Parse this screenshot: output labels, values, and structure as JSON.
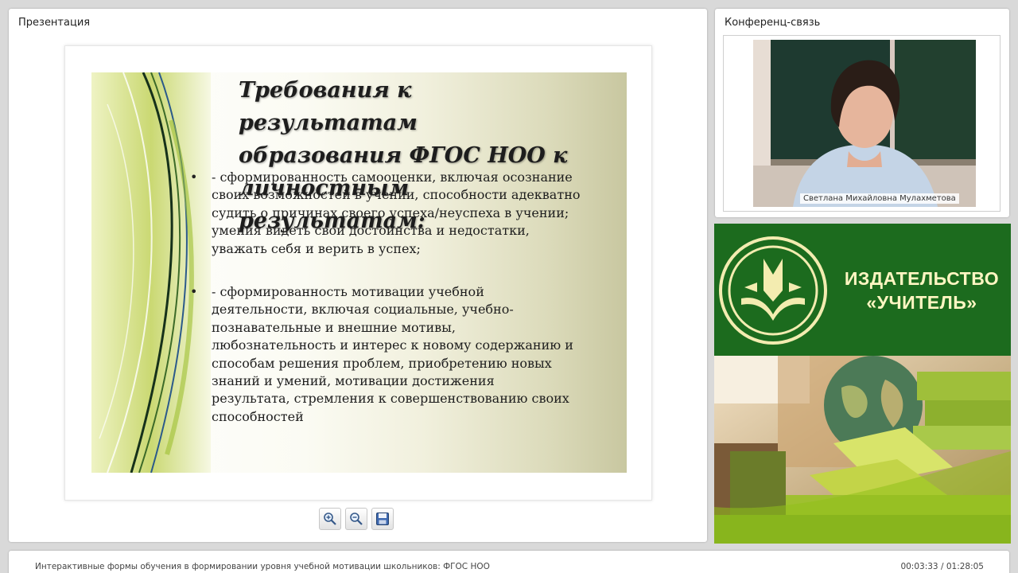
{
  "presentation": {
    "panel_title": "Презентация",
    "slide": {
      "title_lines": [
        "Требования к результатам",
        "образования ФГОС НОО к",
        "личностным результатам:"
      ],
      "bullet_symbol": "•",
      "bullets": [
        {
          "lines": [
            "- сформированность самооценки, включая осознание",
            "своих возможностей в учении, способности адекватно",
            "судить о причинах своего успеха/неуспеха в учении;",
            "умения видеть свои достоинства и недостатки,",
            "уважать себя и верить в успех;"
          ]
        },
        {
          "lines": [
            " - сформированность мотивации учебной",
            "деятельности, включая социальные, учебно-",
            "познавательные и внешние мотивы,",
            "любознательность и интерес к новому содержанию и",
            "способам решения проблем, приобретению новых",
            "знаний и умений, мотивации достижения",
            "результата, стремления к совершенствованию своих",
            "способностей"
          ]
        }
      ]
    },
    "controls": [
      {
        "name": "zoom-in",
        "icon": "zoom-in-icon"
      },
      {
        "name": "zoom-out",
        "icon": "zoom-out-icon"
      },
      {
        "name": "save",
        "icon": "floppy-disk-icon"
      }
    ]
  },
  "conference": {
    "panel_title": "Конференц-связь",
    "speaker_name": "Светлана Михайловна Мулахметова"
  },
  "promo": {
    "publisher_lines": [
      "ИЗДАТЕЛЬСТВО",
      "«УЧИТЕЛЬ»"
    ],
    "colors": {
      "green": "#1c6b1e",
      "text": "#fff6c2"
    }
  },
  "footer": {
    "course_title": "Интерактивные формы обучения в формировании уровня учебной мотивации школьников: ФГОС НОО",
    "time_elapsed": "00:03:33",
    "time_separator": " / ",
    "time_total": "01:28:05"
  }
}
